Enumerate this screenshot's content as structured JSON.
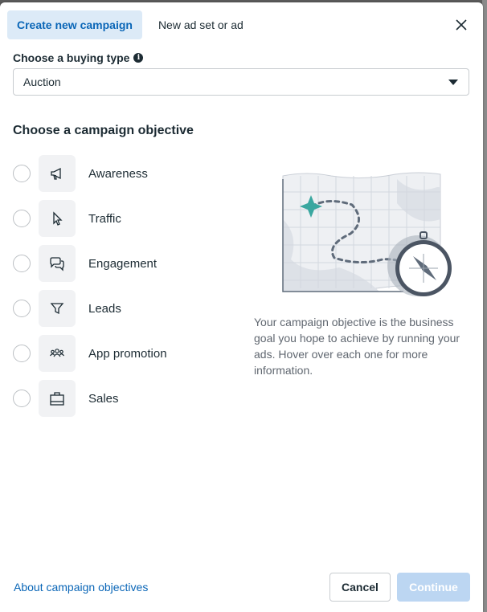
{
  "tabs": [
    {
      "label": "Create new campaign",
      "active": true
    },
    {
      "label": "New ad set or ad",
      "active": false
    }
  ],
  "buying_type": {
    "label": "Choose a buying type",
    "selected": "Auction"
  },
  "objective": {
    "heading": "Choose a campaign objective",
    "options": [
      {
        "label": "Awareness",
        "icon": "megaphone-icon"
      },
      {
        "label": "Traffic",
        "icon": "cursor-icon"
      },
      {
        "label": "Engagement",
        "icon": "chat-bubbles-icon"
      },
      {
        "label": "Leads",
        "icon": "funnel-icon"
      },
      {
        "label": "App promotion",
        "icon": "people-icon"
      },
      {
        "label": "Sales",
        "icon": "shopping-bag-icon"
      }
    ],
    "description": "Your campaign objective is the business goal you hope to achieve by running your ads. Hover over each one for more information."
  },
  "footer": {
    "link": "About campaign objectives",
    "cancel": "Cancel",
    "continue": "Continue"
  },
  "colors": {
    "accent": "#0a66b7",
    "tab_active_bg": "#dceaf7",
    "continue_disabled": "#bcd6f2",
    "illustration_teal": "#3aa7a0"
  }
}
